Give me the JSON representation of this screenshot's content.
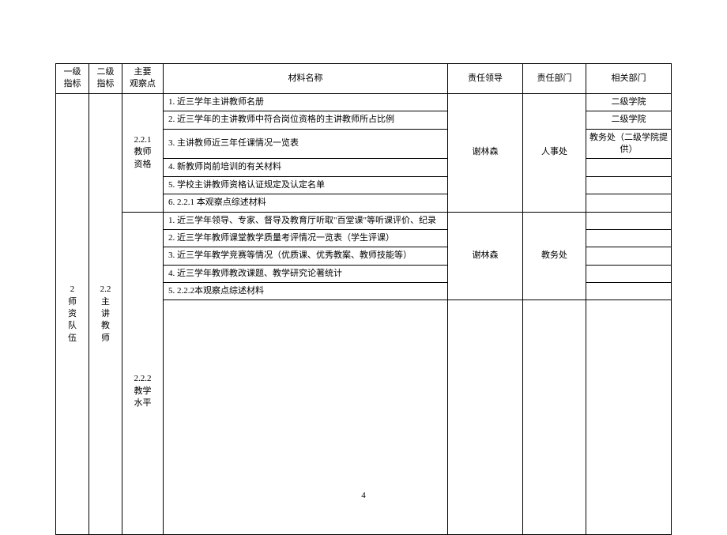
{
  "headers": {
    "col1": "一级\n指标",
    "col2": "二级\n指标",
    "col3": "主要\n观察点",
    "col4": "材料名称",
    "col5": "责任领导",
    "col6": "责任部门",
    "col7": "相关部门"
  },
  "level1": {
    "code": "2",
    "label_line1": "师 资",
    "label_line2": "队伍"
  },
  "level2": {
    "code": "2.2",
    "label_line1": "主 讲",
    "label_line2": "教师"
  },
  "obs1": {
    "code": "2.2.1",
    "label_line1": "教师",
    "label_line2": "资格"
  },
  "obs2": {
    "code": "2.2.2",
    "label_line1": "教学",
    "label_line2": "水平"
  },
  "leader1": "谢林森",
  "leader2": "谢林森",
  "dept1": "人事处",
  "dept2": "教务处",
  "materials1": {
    "m1": "1. 近三学年主讲教师名册",
    "m2": "2. 近三学年的主讲教师中符合岗位资格的主讲教师所占比例",
    "m3": "3. 主讲教师近三年任课情况一览表",
    "m4": "4. 新教师岗前培训的有关材料",
    "m5": "5. 学校主讲教师资格认证规定及认定名单",
    "m6": "6. 2.2.1 本观察点综述材料"
  },
  "materials2": {
    "m1": "1. 近三学年领导、专家、督导及教育厅听取\"百堂课\"等听课评价、纪录",
    "m2": "2. 近三学年教师课堂教学质量考评情况一览表（学生评课）",
    "m3": "3. 近三学年教学竞赛等情况（优质课、优秀教案、教师技能等）",
    "m4": "4. 近三学年教师教改课题、教学研究论著统计",
    "m5": "5. 2.2.2本观察点综述材料"
  },
  "related": {
    "r1": "二级学院",
    "r2": "二级学院",
    "r3": "教务处（二级学院提供）"
  },
  "page_number": "4"
}
